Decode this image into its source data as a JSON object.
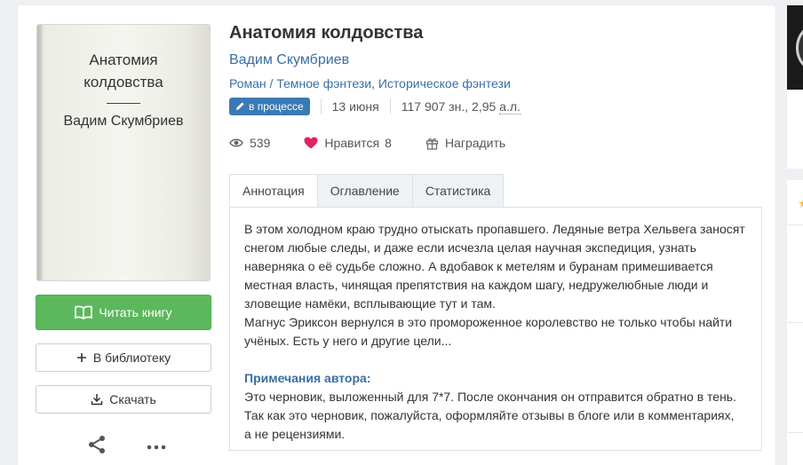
{
  "cover": {
    "title_line1": "Анатомия",
    "title_line2": "колдовства",
    "author": "Вадим Скумбриев"
  },
  "book": {
    "title": "Анатомия колдовства",
    "author": "Вадим Скумбриев",
    "genre1": "Роман",
    "genre_sep": "/",
    "genre2": "Темное фэнтези",
    "genre_comma": ",",
    "genre3": "Историческое фэнтези",
    "status_badge": "в процессе",
    "date": "13 июня",
    "size_prefix": "117 907 зн., 2,95 ",
    "size_unit": "а.л."
  },
  "stats": {
    "views": "539",
    "like_label": "Нравится",
    "likes": "8",
    "reward_label": "Наградить"
  },
  "actions": {
    "read": "Читать книгу",
    "library": "В библиотеку",
    "download": "Скачать"
  },
  "tabs": [
    "Аннотация",
    "Оглавление",
    "Статистика"
  ],
  "annotation": {
    "lines": [
      "В этом холодном краю трудно отыскать пропавшего. Ледяные ветра Хельвега заносят",
      "снегом любые следы, и даже если исчезла целая научная экспедиция, узнать",
      "наверняка о её судьбе сложно. А вдобавок к метелям и буранам примешивается",
      "местная власть, чинящая препятствия на каждом шагу, недружелюбные люди и",
      "зловещие намёки, всплывающие тут и там.",
      "Магнус Эриксон вернулся в это промороженное королевство не только чтобы найти",
      "учёных. Есть у него и другие цели..."
    ],
    "notes_heading": "Примечания автора:",
    "notes_lines": [
      "Это черновик, выложенный для 7*7. После окончания он отправится обратно в тень.",
      "Так как это черновик, пожалуйста, оформляйте отзывы в блоге или в комментариях,",
      "а не рецензиями."
    ]
  },
  "colors": {
    "accent_blue": "#3a6ea5",
    "read_green": "#5cb85c",
    "badge_blue": "#3a7ab4",
    "heart_red": "#e0245e"
  }
}
